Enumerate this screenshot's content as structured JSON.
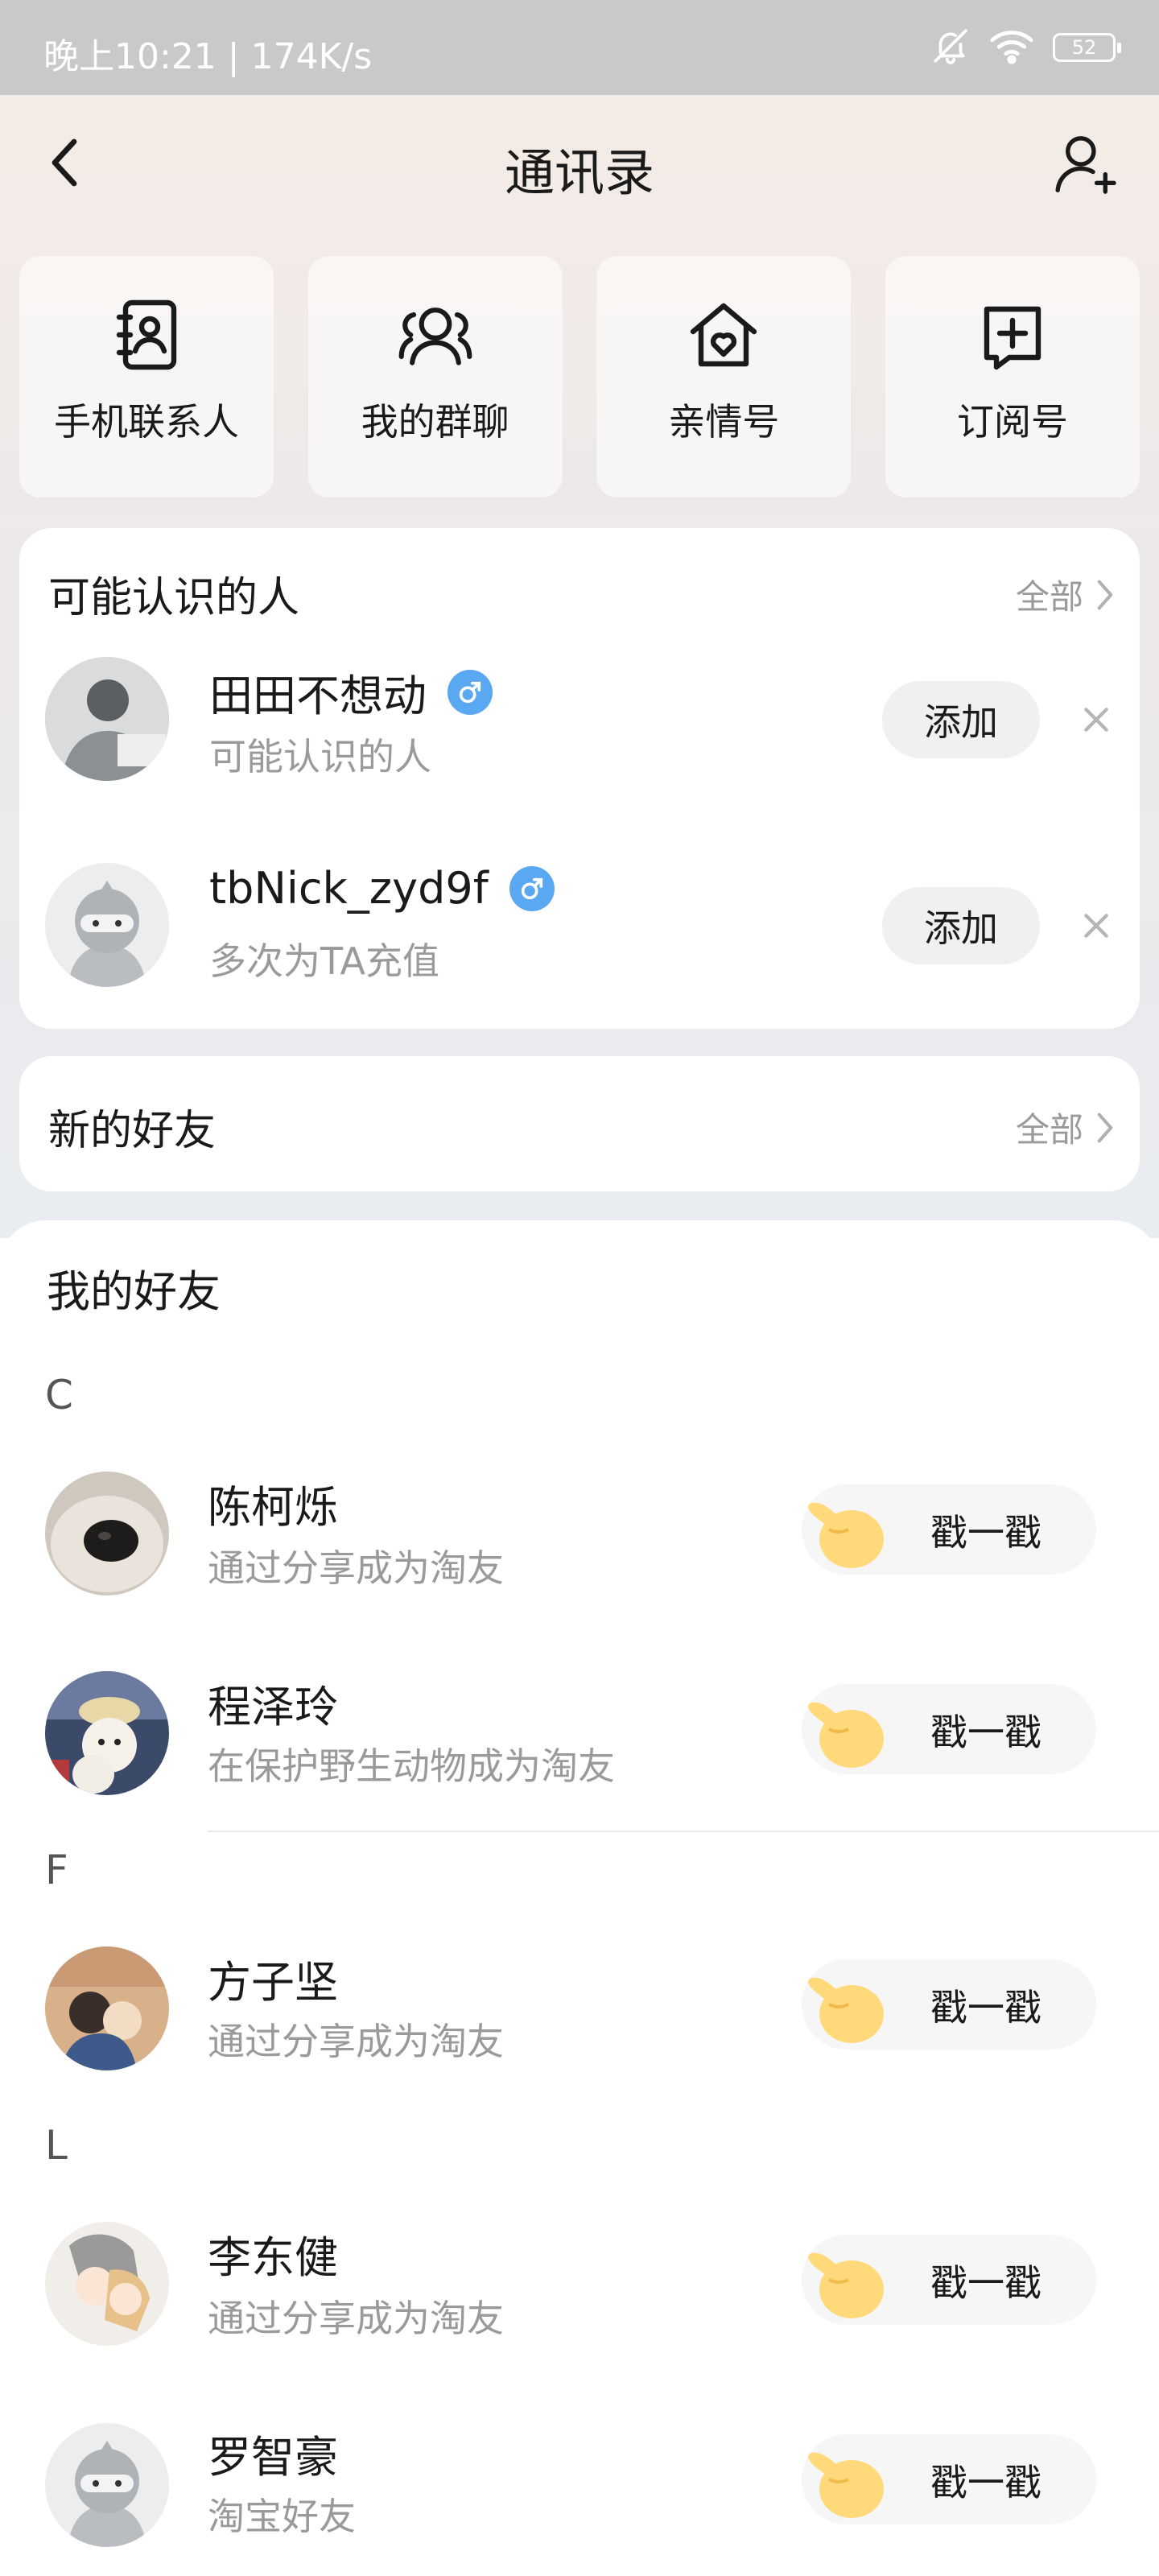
{
  "status_bar": {
    "time_speed": "晚上10:21 | 174K/s",
    "battery": "52"
  },
  "header": {
    "title": "通讯录"
  },
  "tiles": [
    {
      "label": "手机联系人",
      "icon": "contacts-book-icon"
    },
    {
      "label": "我的群聊",
      "icon": "group-chat-icon"
    },
    {
      "label": "亲情号",
      "icon": "family-home-heart-icon"
    },
    {
      "label": "订阅号",
      "icon": "subscription-add-icon"
    }
  ],
  "suggest": {
    "title": "可能认识的人",
    "all_label": "全部",
    "people": [
      {
        "name": "田田不想动",
        "subtitle": "可能认识的人",
        "add_label": "添加"
      },
      {
        "name": "tbNick_zyd9f",
        "subtitle": "多次为TA充值",
        "add_label": "添加"
      }
    ]
  },
  "new_friends": {
    "title": "新的好友",
    "all_label": "全部"
  },
  "friends": {
    "title": "我的好友",
    "poke_label": "戳一戳",
    "letters": [
      "C",
      "F",
      "L"
    ],
    "items": [
      {
        "name": "陈柯烁",
        "subtitle": "通过分享成为淘友"
      },
      {
        "name": "程泽玲",
        "subtitle": "在保护野生动物成为淘友"
      },
      {
        "name": "方子坚",
        "subtitle": "通过分享成为淘友"
      },
      {
        "name": "李东健",
        "subtitle": "通过分享成为淘友"
      },
      {
        "name": "罗智豪",
        "subtitle": "淘宝好友"
      }
    ]
  },
  "colors": {
    "accent_male": "#5aa8f2",
    "poke_hand": "#ffd97a",
    "muted_text": "#9a9a9a"
  }
}
